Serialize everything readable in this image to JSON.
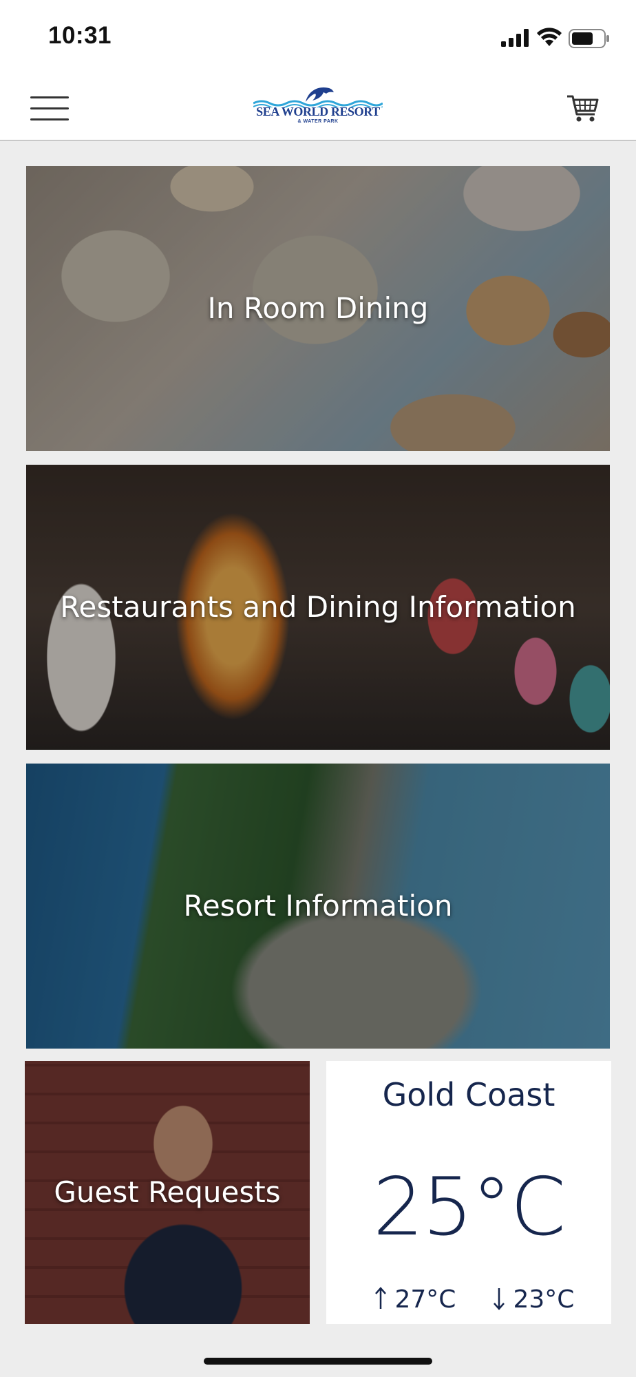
{
  "status_bar": {
    "time": "10:31"
  },
  "header": {
    "logo_name": "SEA WORLD RESORT",
    "logo_sub": "& WATER PARK",
    "menu_icon": "hamburger-menu-icon",
    "cart_icon": "shopping-cart-icon"
  },
  "tiles": [
    {
      "label": "In Room Dining"
    },
    {
      "label": "Restaurants and Dining Information"
    },
    {
      "label": "Resort Information"
    },
    {
      "label": "Guest Requests"
    }
  ],
  "weather": {
    "city": "Gold Coast",
    "temperature": "25°C",
    "high": "27°C",
    "low": "23°C",
    "color": "#16264d"
  },
  "colors": {
    "brand_blue": "#1f3f8e",
    "background": "#ededed"
  }
}
